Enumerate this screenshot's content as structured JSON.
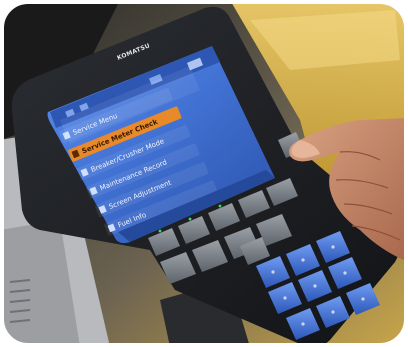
{
  "scene": {
    "description_free": true,
    "device": {
      "brand_label": "KOMATSU",
      "menu_items": [
        {
          "label": "Service Menu",
          "selected": false
        },
        {
          "label": "Service Meter Check",
          "selected": true
        },
        {
          "label": "Breaker/Crusher Mode",
          "selected": false
        },
        {
          "label": "Maintenance Record",
          "selected": false
        },
        {
          "label": "Screen Adjustment",
          "selected": false
        },
        {
          "label": "Fuel Info",
          "selected": false
        }
      ],
      "colors": {
        "screen_blue": "#3f6fd0",
        "highlight_orange": "#e8892a",
        "keypad_blue": "#3a6ad6",
        "bezel": "#1c1e22"
      }
    }
  }
}
